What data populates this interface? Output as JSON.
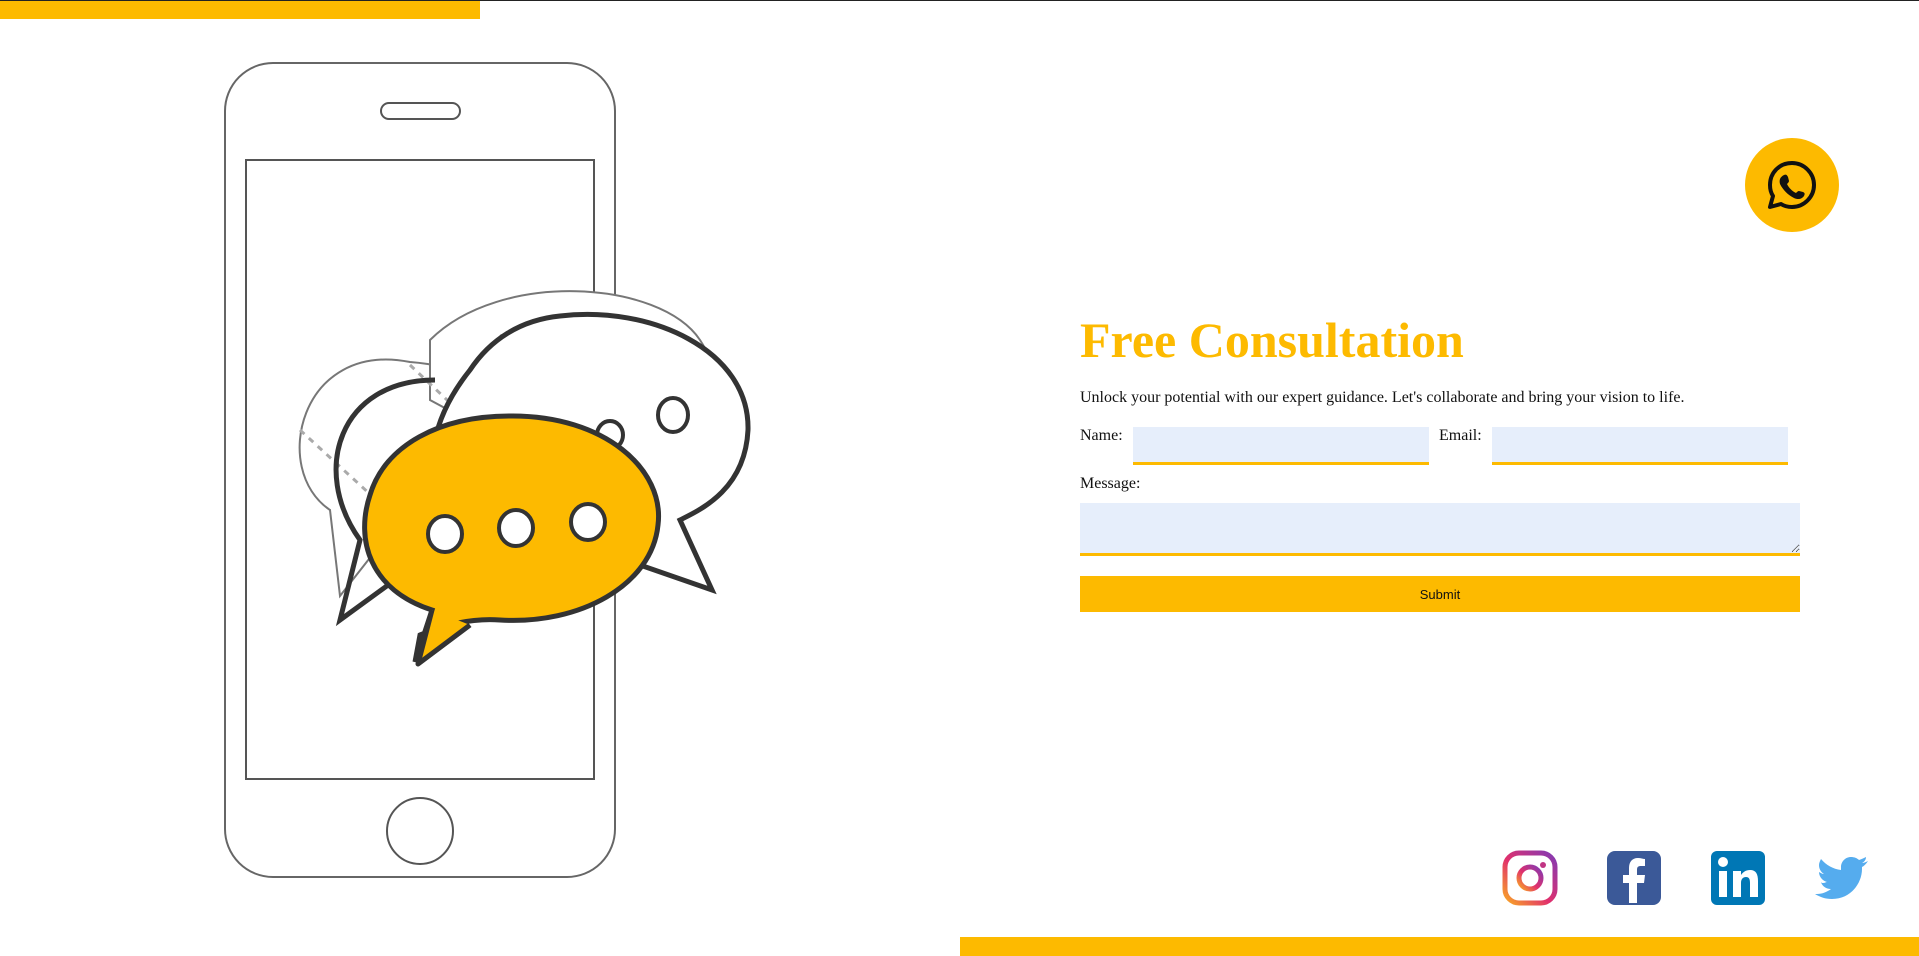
{
  "form": {
    "title": "Free Consultation",
    "subtitle": "Unlock your potential with our expert guidance. Let's collaborate and bring your vision to life.",
    "name_label": "Name:",
    "name_value": "",
    "email_label": "Email:",
    "email_value": "",
    "message_label": "Message:",
    "message_value": "",
    "submit_label": "Submit"
  },
  "icons": {
    "whatsapp": "whatsapp-icon",
    "instagram": "instagram-icon",
    "facebook": "facebook-icon",
    "linkedin": "linkedin-icon",
    "twitter": "twitter-icon",
    "illustration": "phone-chat-illustration"
  },
  "colors": {
    "accent": "#FDBA00",
    "input_background": "#E6EEFB",
    "text": "#111111",
    "facebook": "#3B5998",
    "linkedin": "#0077B5",
    "twitter": "#55ACEE"
  }
}
